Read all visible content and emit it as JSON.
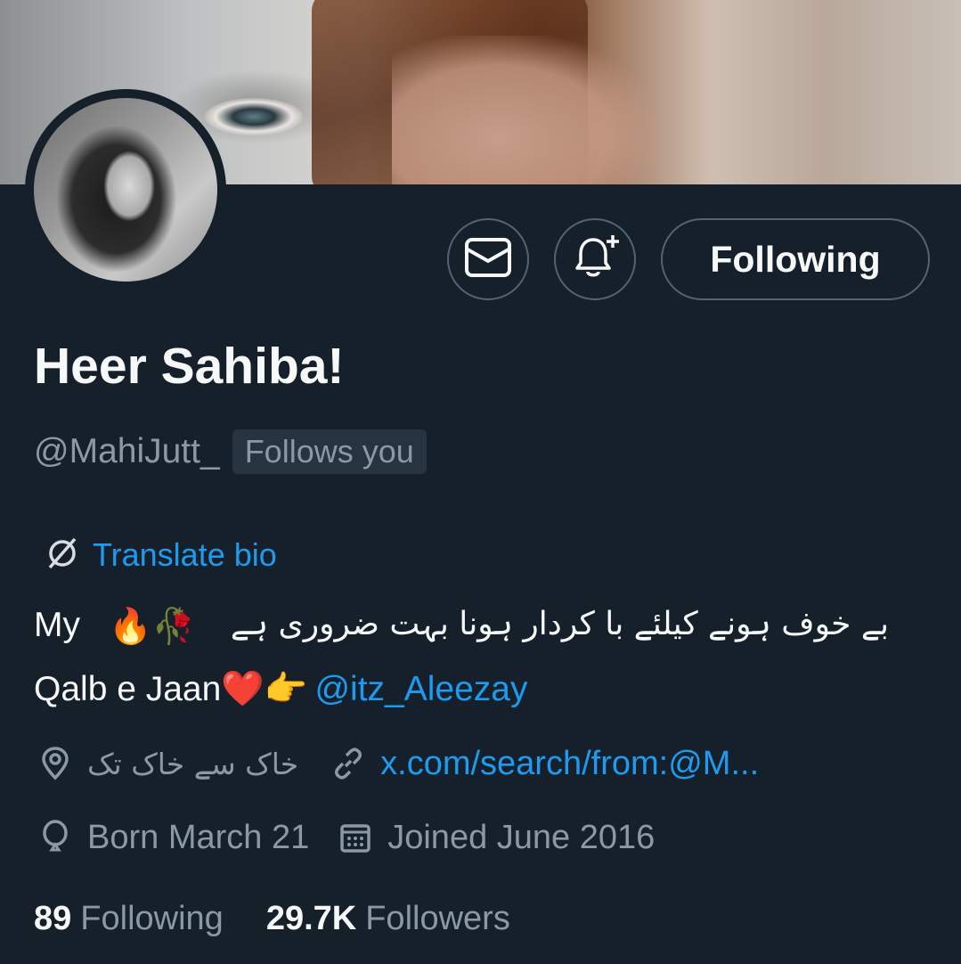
{
  "profile": {
    "name": "Heer Sahiba!",
    "handle": "@MahiJutt_",
    "follows_you": "Follows you",
    "follow_button": "Following"
  },
  "translate": {
    "label": "Translate bio"
  },
  "bio": {
    "line1_prefix": "My",
    "line1_emoji": "🔥🥀",
    "line1_urdu": "بے خوف ہونے کیلئے با کردار ہونا بہت ضروری ہے",
    "line2_text": "Qalb e Jaan❤️👉",
    "mention": "@itz_Aleezay"
  },
  "meta": {
    "location": "خاک سے خاک تک",
    "website": "x.com/search/from:@M...",
    "birthday": "Born March 21",
    "joined": "Joined June 2016"
  },
  "stats": {
    "following_count": "89",
    "following_label": "Following",
    "followers_count": "29.7K",
    "followers_label": "Followers"
  },
  "icons": {
    "message": "envelope-icon",
    "notify": "bell-plus-icon",
    "translate": "translate-icon",
    "location": "location-pin-icon",
    "link": "link-icon",
    "birthday": "balloon-icon",
    "calendar": "calendar-icon"
  },
  "colors": {
    "background": "#15202b",
    "accent": "#1d9bf0",
    "secondary_text": "#8b98a5",
    "border": "#536471"
  }
}
